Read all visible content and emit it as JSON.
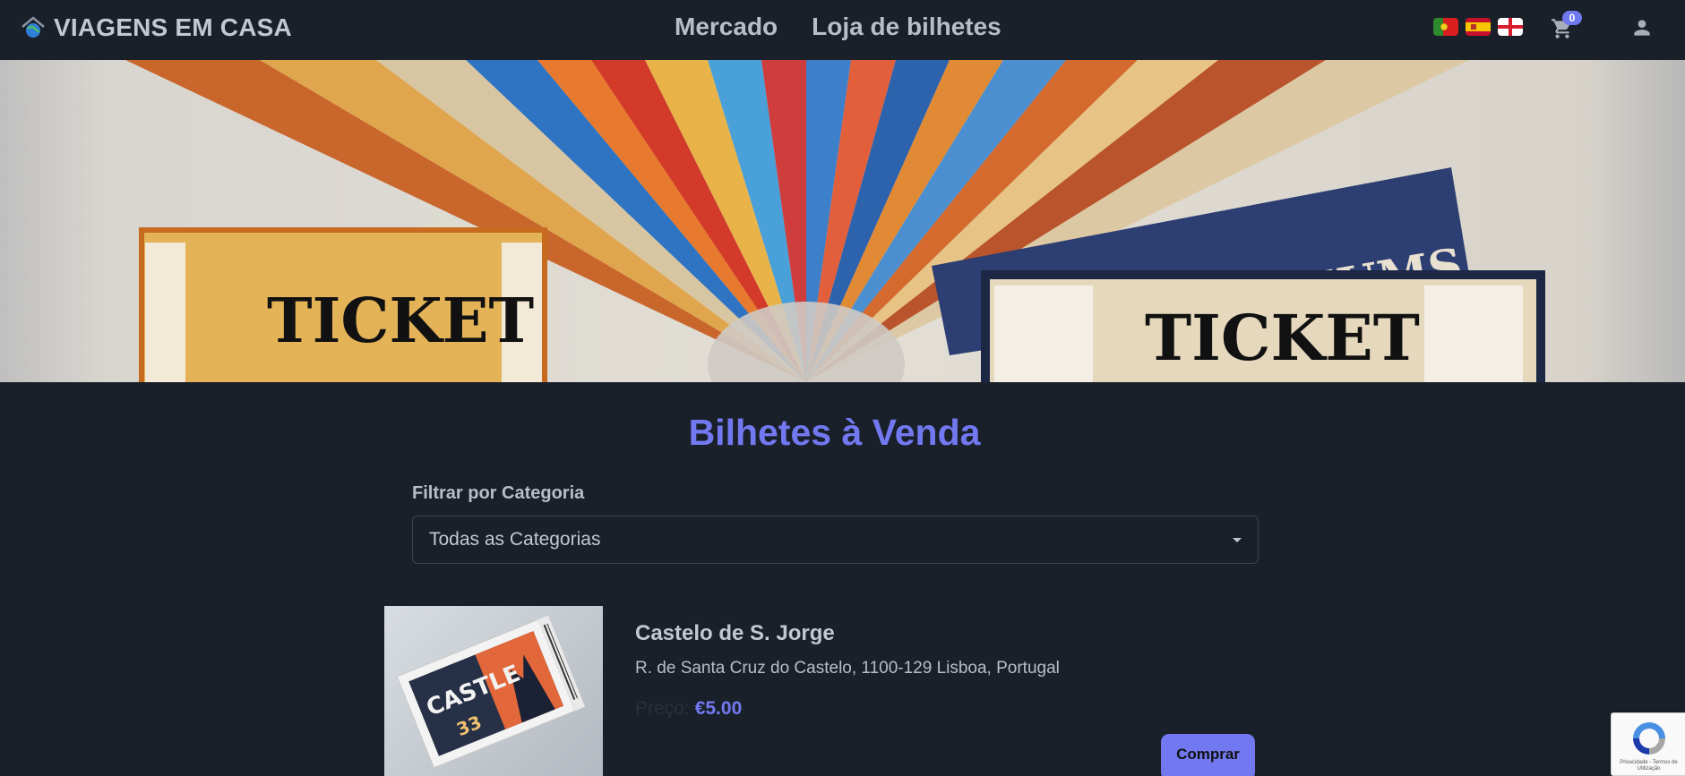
{
  "navbar": {
    "brand": "VIAGENS EM CASA",
    "links": [
      {
        "label": "Mercado"
      },
      {
        "label": "Loja de bilhetes"
      }
    ],
    "cart_count": "0"
  },
  "hero": {
    "ticket_left_text": "TICKET",
    "ticket_right_text": "TICKET",
    "museums_text": "MUSEUMS"
  },
  "main": {
    "title": "Bilhetes à Venda",
    "filter": {
      "label": "Filtrar por Categoria",
      "selected": "Todas as Categorias"
    },
    "tickets": [
      {
        "name": "Castelo de S. Jorge",
        "address": "R. de Santa Cruz do Castelo, 1100-129 Lisboa, Portugal",
        "price_label": "Preço:",
        "price": "€5.00",
        "buy_label": "Comprar",
        "image_text": "CASTLE",
        "image_number": "33"
      }
    ]
  },
  "recaptcha": {
    "text": "Privacidade - Termos de Utilização"
  },
  "colors": {
    "background": "#1a202a",
    "accent": "#7279f0"
  }
}
